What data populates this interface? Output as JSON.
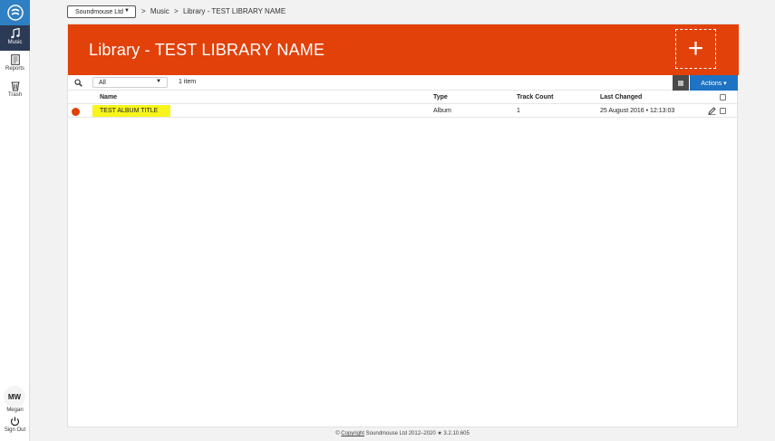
{
  "sidebar": {
    "nav": [
      {
        "label": "Music",
        "icon": "music-note-icon",
        "active": true
      },
      {
        "label": "Reports",
        "icon": "reports-icon",
        "active": false
      },
      {
        "label": "Trash",
        "icon": "trash-icon",
        "active": false
      }
    ],
    "user": {
      "initials": "MW",
      "name": "Megan"
    },
    "signout_label": "Sign Out"
  },
  "topbar": {
    "org": "Soundmouse Ltd",
    "breadcrumb": [
      ">",
      "Music",
      ">",
      "Library - TEST LIBRARY NAME"
    ]
  },
  "banner": {
    "title": "Library - TEST LIBRARY NAME",
    "add_symbol": "+",
    "color": "#e2410a"
  },
  "toolbar": {
    "filter_value": "All",
    "item_count": "1 item",
    "actions_label": "Actions ▾"
  },
  "table": {
    "headers": {
      "name": "Name",
      "type": "Type",
      "track_count": "Track Count",
      "last_changed": "Last Changed"
    },
    "rows": [
      {
        "name": "TEST ALBUM TITLE",
        "type": "Album",
        "track_count": "1",
        "last_changed": "25 August 2016 • 12:13:03",
        "status_color": "#e2410a"
      }
    ]
  },
  "footer": {
    "prefix": "©",
    "copyright_link": "Copyright",
    "text": "Soundmouse Ltd 2012–2020 ★ 3.2.10.605"
  }
}
